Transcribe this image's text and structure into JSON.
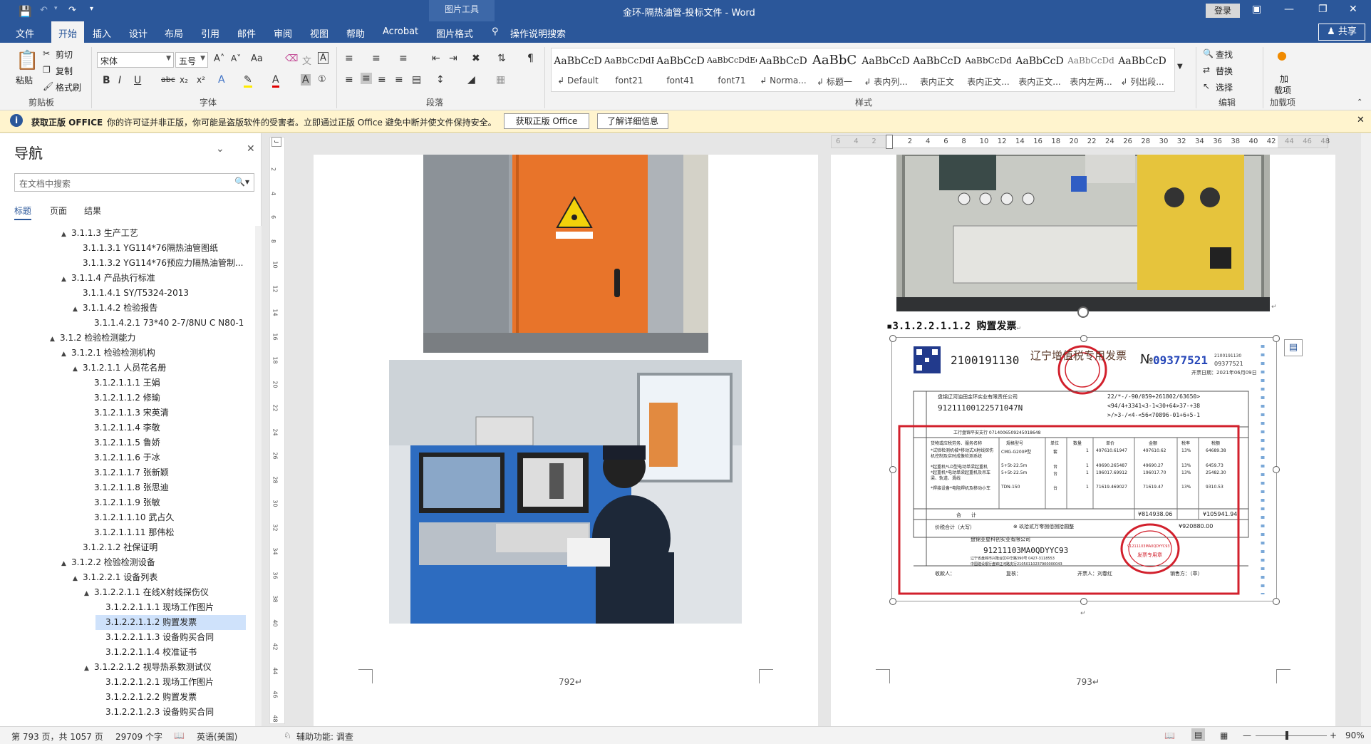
{
  "titlebar": {
    "context_tab_label": "图片工具",
    "doc_title": "金环-隔热油管-投标文件",
    "app_name": "Word",
    "login_label": "登录"
  },
  "tabs": [
    "文件",
    "开始",
    "插入",
    "设计",
    "布局",
    "引用",
    "邮件",
    "审阅",
    "视图",
    "帮助",
    "Acrobat",
    "图片格式"
  ],
  "active_tab": "开始",
  "tell_me": "操作说明搜索",
  "share_label": "共享",
  "ribbon": {
    "clipboard": {
      "paste": "粘贴",
      "cut": "剪切",
      "copy": "复制",
      "format_painter": "格式刷",
      "group": "剪贴板"
    },
    "font": {
      "name": "宋体",
      "size": "五号",
      "group": "字体"
    },
    "paragraph_group": "段落",
    "styles_group": "样式",
    "styles": [
      {
        "preview": "AaBbCcD",
        "name": "Default"
      },
      {
        "preview": "AaBbCcDdE",
        "name": "font21"
      },
      {
        "preview": "AaBbCcD",
        "name": "font41"
      },
      {
        "preview": "AaBbCcDdEe",
        "name": "font71"
      },
      {
        "preview": "AaBbCcD",
        "name": "Norma..."
      },
      {
        "preview": "AaBbC",
        "name": "标题一"
      },
      {
        "preview": "AaBbCcD",
        "name": "表内列..."
      },
      {
        "preview": "AaBbCcD",
        "name": "表内正文"
      },
      {
        "preview": "AaBbCcDd",
        "name": "表内正文..."
      },
      {
        "preview": "AaBbCcD",
        "name": "表内正文..."
      },
      {
        "preview": "AaBbCcDd",
        "name": "表内左两..."
      },
      {
        "preview": "AaBbCcD",
        "name": "列出段..."
      }
    ],
    "editing": {
      "find": "查找",
      "replace": "替换",
      "select": "选择",
      "group": "编辑"
    },
    "addins": {
      "label1": "加",
      "label2": "载项",
      "group": "加载项"
    }
  },
  "warning": {
    "title": "获取正版 OFFICE",
    "message": "你的许可证并非正版，你可能是盗版软件的受害者。立即通过正版 Office 避免中断并使文件保持安全。",
    "btn_get": "获取正版 Office",
    "btn_more": "了解详细信息"
  },
  "nav": {
    "title": "导航",
    "search_placeholder": "在文档中搜索",
    "tabs": [
      "标题",
      "页面",
      "结果"
    ],
    "items": [
      {
        "level": 1,
        "text": "3.1.1.3 生产工艺",
        "exp": "▲"
      },
      {
        "level": 2,
        "text": "3.1.1.3.1 YG114*76隔热油管图纸",
        "exp": ""
      },
      {
        "level": 2,
        "text": "3.1.1.3.2 YG114*76预应力隔热油管制...",
        "exp": ""
      },
      {
        "level": 1,
        "text": "3.1.1.4 产品执行标准",
        "exp": "▲"
      },
      {
        "level": 2,
        "text": "3.1.1.4.1 SY/T5324-2013",
        "exp": ""
      },
      {
        "level": 2,
        "text": "3.1.1.4.2 检验报告",
        "exp": "▲"
      },
      {
        "level": 3,
        "text": "3.1.1.4.2.1 73*40 2-7/8NU C N80-1",
        "exp": ""
      },
      {
        "level": 0,
        "text": "3.1.2 检验检测能力",
        "exp": "▲"
      },
      {
        "level": 1,
        "text": "3.1.2.1 检验检测机构",
        "exp": "▲"
      },
      {
        "level": 2,
        "text": "3.1.2.1.1 人员花名册",
        "exp": "▲"
      },
      {
        "level": 3,
        "text": "3.1.2.1.1.1 王娟",
        "exp": ""
      },
      {
        "level": 3,
        "text": "3.1.2.1.1.2 修瑜",
        "exp": ""
      },
      {
        "level": 3,
        "text": "3.1.2.1.1.3 宋英清",
        "exp": ""
      },
      {
        "level": 3,
        "text": "3.1.2.1.1.4 李敬",
        "exp": ""
      },
      {
        "level": 3,
        "text": "3.1.2.1.1.5 鲁娇",
        "exp": ""
      },
      {
        "level": 3,
        "text": "3.1.2.1.1.6 于冰",
        "exp": ""
      },
      {
        "level": 3,
        "text": "3.1.2.1.1.7 张新颖",
        "exp": ""
      },
      {
        "level": 3,
        "text": "3.1.2.1.1.8 张思迪",
        "exp": ""
      },
      {
        "level": 3,
        "text": "3.1.2.1.1.9 张敏",
        "exp": ""
      },
      {
        "level": 3,
        "text": "3.1.2.1.1.10 武占久",
        "exp": ""
      },
      {
        "level": 3,
        "text": "3.1.2.1.1.11 那伟松",
        "exp": ""
      },
      {
        "level": 2,
        "text": "3.1.2.1.2 社保证明",
        "exp": ""
      },
      {
        "level": 1,
        "text": "3.1.2.2 检验检测设备",
        "exp": "▲"
      },
      {
        "level": 2,
        "text": "3.1.2.2.1 设备列表",
        "exp": "▲"
      },
      {
        "level": 3,
        "text": "3.1.2.2.1.1 在线X射线探伤仪",
        "exp": "▲"
      },
      {
        "level": 4,
        "text": "3.1.2.2.1.1.1 现场工作图片",
        "exp": ""
      },
      {
        "level": 4,
        "text": "3.1.2.2.1.1.2 购置发票",
        "exp": "",
        "selected": true
      },
      {
        "level": 4,
        "text": "3.1.2.2.1.1.3 设备购买合同",
        "exp": ""
      },
      {
        "level": 4,
        "text": "3.1.2.2.1.1.4 校准证书",
        "exp": ""
      },
      {
        "level": 3,
        "text": "3.1.2.2.1.2 视导热系数测试仪",
        "exp": "▲"
      },
      {
        "level": 4,
        "text": "3.1.2.2.1.2.1 现场工作图片",
        "exp": ""
      },
      {
        "level": 4,
        "text": "3.1.2.2.1.2.2 购置发票",
        "exp": ""
      },
      {
        "level": 4,
        "text": "3.1.2.2.1.2.3 设备购买合同",
        "exp": ""
      }
    ]
  },
  "ruler_ticks": [
    "6",
    "4",
    "2",
    "",
    "2",
    "4",
    "6",
    "8",
    "10",
    "12",
    "14",
    "16",
    "18",
    "20",
    "22",
    "24",
    "26",
    "28",
    "30",
    "32",
    "34",
    "36",
    "38",
    "40",
    "42",
    "44",
    "46",
    "48"
  ],
  "vruler_ticks": [
    "2",
    "4",
    "6",
    "8",
    "10",
    "12",
    "14",
    "16",
    "18",
    "20",
    "22",
    "24",
    "26",
    "28",
    "30",
    "32",
    "34",
    "36",
    "38",
    "40",
    "42",
    "44",
    "46",
    "48"
  ],
  "page_left": {
    "page_number": "792"
  },
  "page_right": {
    "heading": "3.1.2.2.1.1.2 购置发票",
    "page_number": "793"
  },
  "invoice": {
    "code": "2100191130",
    "title": "辽宁增值税专用发票",
    "no_prefix": "№",
    "number": "09377521",
    "side_code": "2100191130",
    "side_number": "09377521",
    "date": "开票日期：2021年06月09日",
    "buyer_name": "盘锦辽河油田金环实业有限责任公司",
    "buyer_taxid": "91211100122571047N",
    "cipher1": "22/*-/-90/059+261802/63650>",
    "cipher2": "<94/4+3341<3-1<30+64>37-+38",
    "cipher3": ">/>3-/<4-<56<70896-01+6+5-1",
    "bank": "工行盘锦平安支行 0714006509245018648",
    "items_header": "货物或应税劳务、服务名称",
    "spec_header": "规格型号",
    "unit_header": "单位",
    "qty_header": "数量",
    "price_header": "单价",
    "amount_header": "金额",
    "rate_header": "税率",
    "tax_header": "税额",
    "item1": "*试验检测机械*移动式X射线探伤机控制及实时成像检测系统",
    "item2": "*起重机*LD型电动单梁起重机",
    "item3": "*起重机*电动单梁起重机及吊车梁、轨道、滑线",
    "item4": "*焊接设备*电阻焊机及移动小车",
    "spec1": "CMG-G200P型",
    "spec2": "5+5t-22.5m",
    "spec3": "5+5t-22.5m",
    "spec4": "TDN-150",
    "unit1": "套",
    "unit2": "台",
    "unit3": "台",
    "unit4": "台",
    "qty1": "1",
    "qty2": "1",
    "qty3": "1",
    "qty4": "1",
    "price1": "497610.61947",
    "price2": "49690.265487",
    "price3": "196017.69912",
    "price4": "71619.469027",
    "amt1": "497610.62",
    "amt2": "49690.27",
    "amt3": "196017.70",
    "amt4": "71619.47",
    "rate1": "13%",
    "rate2": "13%",
    "rate3": "13%",
    "rate4": "13%",
    "tax1": "64689.38",
    "tax2": "6459.73",
    "tax3": "25482.30",
    "tax4": "9310.53",
    "total_label": "合　　计",
    "total_amount": "¥814938.06",
    "total_tax": "¥105941.94",
    "grand_label": "价税合计（大写）",
    "grand_words": "玖拾贰万零捌佰捌拾圆整",
    "grand_small": "¥920880.00",
    "seller_name": "盘锦亚星科创实业有限公司",
    "seller_taxid": "91211103MA0QDYYC93",
    "seller_bank": "中国建设银行盘锦辽河路支行21050110237900000043",
    "seller_addr": "辽宁省盘锦市兴隆台区中华路390号 0427-3118553",
    "payee": "收款人：",
    "reviewer": "复核：",
    "issuer": "开票人：刘春红",
    "seller_stamp": "销售方：（章）",
    "stamp1": "发票专用章",
    "stamp2": "91211103MA0QDYYC93"
  },
  "status": {
    "page": "第 793 页，共 1057 页",
    "words": "29709 个字",
    "lang": "英语(美国)",
    "access": "辅助功能: 调查",
    "zoom": "90%"
  },
  "colors": {
    "accent": "#2b579a",
    "warning_bg": "#fff4ce",
    "selected_nav": "#cfe2fb",
    "invoice_red": "#d2202c"
  }
}
